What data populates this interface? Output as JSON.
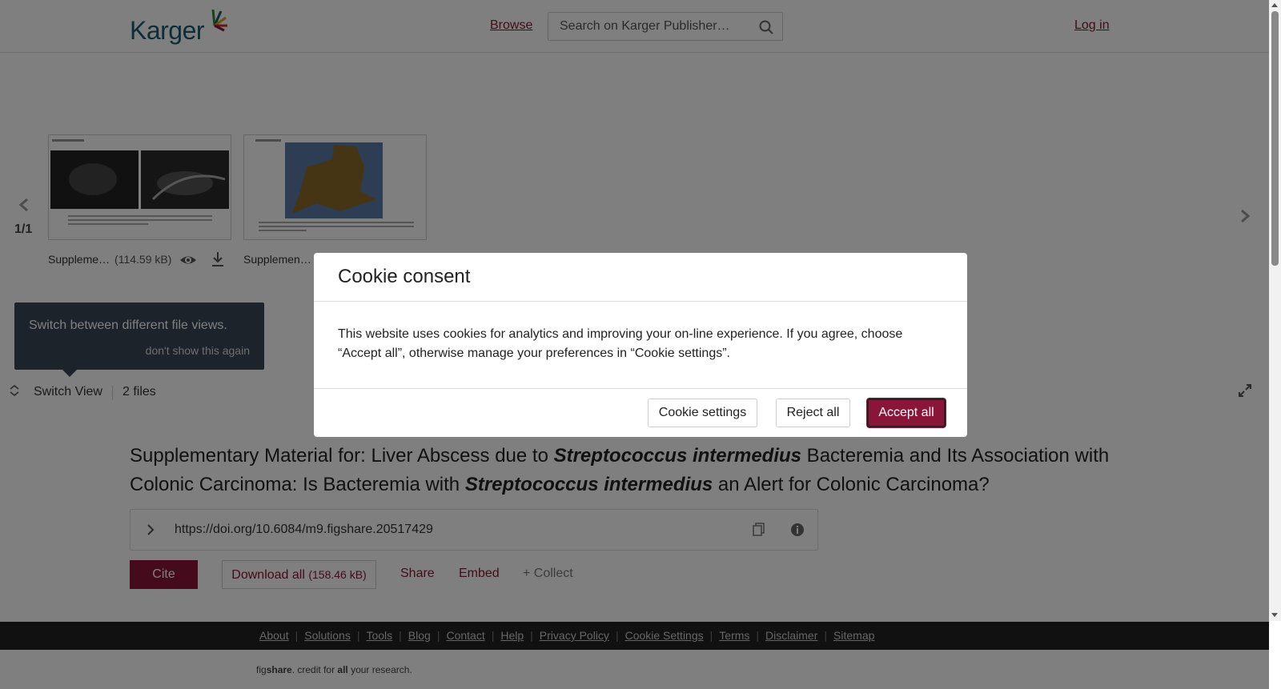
{
  "header": {
    "logo_text": "Karger",
    "browse": "Browse",
    "search_placeholder": "Search on Karger Publisher…",
    "login": "Log in"
  },
  "viewer": {
    "page_count": "1/1",
    "files": [
      {
        "name": "Suppleme…",
        "size": "(114.59 kB)"
      },
      {
        "name": "Supplemen…"
      }
    ],
    "tooltip": {
      "text": "Switch between different file views.",
      "dismiss": "don't show this again"
    },
    "switch_view": "Switch View",
    "file_count": "2 files"
  },
  "article": {
    "title_parts": [
      "Supplementary Material for: Liver Abscess due to ",
      "Streptococcus intermedius",
      " Bacteremia and Its Association with Colonic Carcinoma: Is Bacteremia with ",
      "Streptococcus intermedius",
      " an Alert for Colonic Carcinoma?"
    ],
    "doi": "https://doi.org/10.6084/m9.figshare.20517429",
    "cite": "Cite",
    "download_all": "Download all",
    "download_size": "(158.46 kB)",
    "share": "Share",
    "embed": "Embed",
    "collect": "+ Collect"
  },
  "footer": {
    "links": [
      "About",
      "Solutions",
      "Tools",
      "Blog",
      "Contact",
      "Help",
      "Privacy Policy",
      "Cookie Settings",
      "Terms",
      "Disclaimer",
      "Sitemap"
    ],
    "credit_parts": [
      "fig",
      "share",
      ". credit for ",
      "all",
      " your research."
    ]
  },
  "cookie_modal": {
    "title": "Cookie consent",
    "body": "This website uses cookies for analytics and improving your on-line experience. If you agree, choose “Accept all”, otherwise manage your preferences in “Cookie settings”.",
    "settings": "Cookie settings",
    "reject": "Reject all",
    "accept": "Accept all"
  },
  "colors": {
    "brand": "#8b1538",
    "logo": "#1b5c6e",
    "tooltip_bg": "#394655",
    "footer_bg": "#232323"
  }
}
